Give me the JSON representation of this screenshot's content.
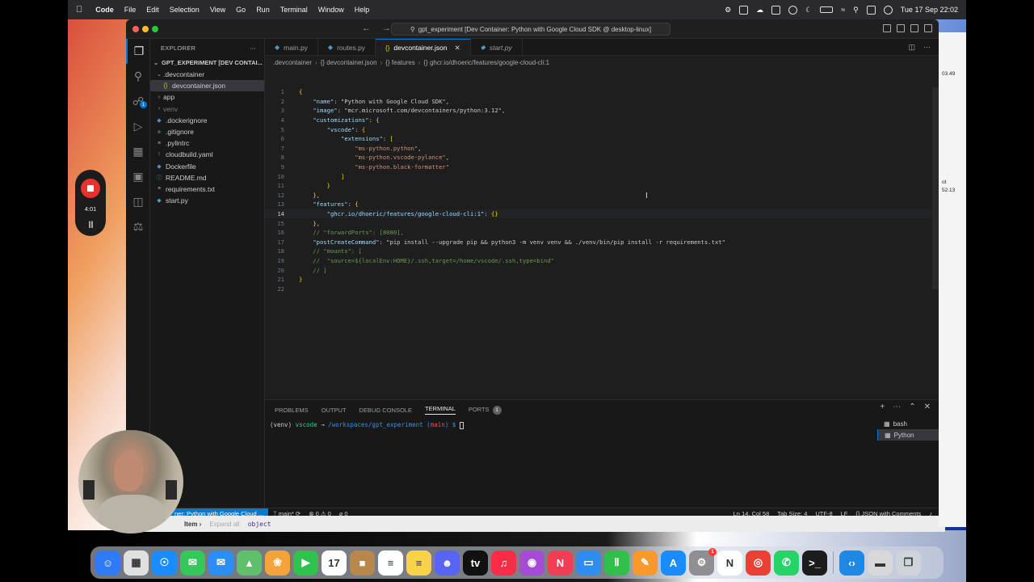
{
  "menubar": {
    "app_name": "Code",
    "items": [
      "File",
      "Edit",
      "Selection",
      "View",
      "Go",
      "Run",
      "Terminal",
      "Window",
      "Help"
    ],
    "clock": "Tue 17 Sep  22:02"
  },
  "window": {
    "command_center": "gpt_experiment [Dev Container: Python with Google Cloud SDK @ desktop-linux]"
  },
  "sidebar": {
    "title": "EXPLORER",
    "root": "GPT_EXPERIMENT [DEV CONTAI...",
    "items": [
      {
        "label": ".devcontainer",
        "icon": "chevron-down"
      },
      {
        "label": "devcontainer.json",
        "icon": "json"
      },
      {
        "label": "app",
        "icon": "chevron-right"
      },
      {
        "label": "venv",
        "icon": "chevron-right"
      },
      {
        "label": ".dockerignore",
        "icon": "docker"
      },
      {
        "label": ".gitignore",
        "icon": "git"
      },
      {
        "label": ".pylintrc",
        "icon": "lines"
      },
      {
        "label": "cloudbuild.yaml",
        "icon": "exclamation"
      },
      {
        "label": "Dockerfile",
        "icon": "docker"
      },
      {
        "label": "README.md",
        "icon": "info"
      },
      {
        "label": "requirements.txt",
        "icon": "lines"
      },
      {
        "label": "start.py",
        "icon": "python"
      }
    ],
    "activity_badge": "1"
  },
  "tabs": [
    {
      "label": "main.py",
      "icon": "python"
    },
    {
      "label": "routes.py",
      "icon": "python"
    },
    {
      "label": "devcontainer.json",
      "icon": "json"
    },
    {
      "label": "start.py",
      "icon": "python"
    }
  ],
  "breadcrumb": [
    ".devcontainer",
    "{} devcontainer.json",
    "{} features",
    "{} ghcr.io/dhoeric/features/google-cloud-cli:1"
  ],
  "code_lines": [
    "{",
    "    \"name\": \"Python with Google Cloud SDK\",",
    "    \"image\": \"mcr.microsoft.com/devcontainers/python:3.12\",",
    "    \"customizations\": {",
    "        \"vscode\": {",
    "            \"extensions\": [",
    "                \"ms-python.python\",",
    "                \"ms-python.vscode-pylance\",",
    "                \"ms-python.black-formatter\"",
    "            ]",
    "        }",
    "    },",
    "    \"features\": {",
    "        \"ghcr.io/dhoeric/features/google-cloud-cli:1\": {}",
    "    },",
    "    // \"forwardPorts\": [8080],",
    "    \"postCreateCommand\": \"pip install --upgrade pip && python3 -m venv venv && ./venv/bin/pip install -r requirements.txt\"",
    "    // \"mounts\": [",
    "    //  \"source=${localEnv:HOME}/.ssh,target=/home/vscode/.ssh,type=bind\"",
    "    // ]",
    "}",
    ""
  ],
  "panel": {
    "tabs": [
      "PROBLEMS",
      "OUTPUT",
      "DEBUG CONSOLE",
      "TERMINAL",
      "PORTS"
    ],
    "ports_badge": "1",
    "prompt_venv": "(venv) ",
    "prompt_user": "vscode",
    "prompt_arrow": " → ",
    "prompt_path": "/workspaces/gpt_experiment",
    "prompt_branch_open": " (",
    "prompt_branch": "main",
    "prompt_branch_close": ") $ ",
    "terminals": [
      "bash",
      "Python"
    ]
  },
  "statusbar": {
    "remote": "ner: Python with Google Cloud ...",
    "branch": "main*",
    "errors": "⊗ 0 ⚠ 0",
    "ports": "⌀ 0",
    "position": "Ln 14, Col 58",
    "tab_size": "Tab Size: 4",
    "encoding": "UTF-8",
    "eol": "LF",
    "language": "{} JSON with Comments"
  },
  "inspector": {
    "item": "Item ›",
    "expand": "Expand all",
    "type": "object"
  },
  "recorder": {
    "time": "4:01"
  },
  "right_window": {
    "t1": "03.49",
    "t2": "ot",
    "t3": "52.13"
  },
  "dock": {
    "apps": [
      {
        "name": "finder",
        "glyph": "☺",
        "color": "#2f7bf5"
      },
      {
        "name": "launchpad",
        "glyph": "▦",
        "color": "#e0e0e0"
      },
      {
        "name": "safari",
        "glyph": "☉",
        "color": "#1a8cff"
      },
      {
        "name": "messages",
        "glyph": "✉",
        "color": "#34c759"
      },
      {
        "name": "mail",
        "glyph": "✉",
        "color": "#2b8ef5"
      },
      {
        "name": "maps",
        "glyph": "▲",
        "color": "#5fbf6b"
      },
      {
        "name": "photos",
        "glyph": "❀",
        "color": "#f3a33a"
      },
      {
        "name": "facetime",
        "glyph": "▶",
        "color": "#2fc24e"
      },
      {
        "name": "calendar",
        "glyph": "17",
        "color": "#ffffff"
      },
      {
        "name": "notes-brown",
        "glyph": "■",
        "color": "#b8874a"
      },
      {
        "name": "reminders",
        "glyph": "≡",
        "color": "#ffffff"
      },
      {
        "name": "notes",
        "glyph": "≡",
        "color": "#f8d34a"
      },
      {
        "name": "discord",
        "glyph": "☻",
        "color": "#5865f2"
      },
      {
        "name": "apple-tv",
        "glyph": "tv",
        "color": "#111111"
      },
      {
        "name": "music",
        "glyph": "♫",
        "color": "#fa2d48"
      },
      {
        "name": "podcasts",
        "glyph": "◉",
        "color": "#a64bd8"
      },
      {
        "name": "news",
        "glyph": "N",
        "color": "#f23e55"
      },
      {
        "name": "keynote",
        "glyph": "▭",
        "color": "#2f8cf0"
      },
      {
        "name": "numbers",
        "glyph": "Ⅱ",
        "color": "#2fbf4a"
      },
      {
        "name": "pages",
        "glyph": "✎",
        "color": "#f8992b"
      },
      {
        "name": "app-store",
        "glyph": "A",
        "color": "#1a8cff"
      },
      {
        "name": "system-settings",
        "glyph": "⚙",
        "color": "#8e8e93"
      },
      {
        "name": "notion",
        "glyph": "N",
        "color": "#ffffff"
      },
      {
        "name": "chrome",
        "glyph": "◎",
        "color": "#e94235"
      },
      {
        "name": "whatsapp",
        "glyph": "✆",
        "color": "#25d366"
      },
      {
        "name": "terminal",
        "glyph": ">_",
        "color": "#1c1c1c"
      },
      {
        "name": "vscode",
        "glyph": "‹›",
        "color": "#1e88e5"
      },
      {
        "name": "scanner",
        "glyph": "▬",
        "color": "#d8d8d8"
      },
      {
        "name": "trash",
        "glyph": "❒",
        "color": "#cfd3da"
      }
    ],
    "settings_badge": "1"
  }
}
